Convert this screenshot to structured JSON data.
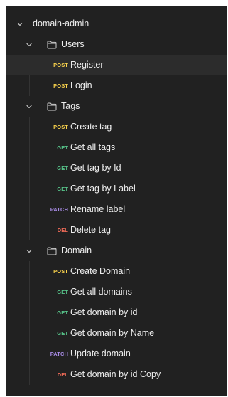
{
  "colors": {
    "POST": "#f8d14c",
    "GET": "#57c289",
    "PATCH": "#a78be4",
    "DEL": "#ec6a57",
    "text": "#ededed",
    "icon": "#cfcfcf",
    "background": "#212121",
    "selected": "#2c2c2c"
  },
  "collection": {
    "name": "domain-admin",
    "expanded": true
  },
  "folders": [
    {
      "name": "Users",
      "expanded": true,
      "requests": [
        {
          "method": "POST",
          "name": "Register",
          "selected": true
        },
        {
          "method": "POST",
          "name": "Login"
        }
      ]
    },
    {
      "name": "Tags",
      "expanded": true,
      "requests": [
        {
          "method": "POST",
          "name": "Create tag"
        },
        {
          "method": "GET",
          "name": "Get all tags"
        },
        {
          "method": "GET",
          "name": "Get tag by Id"
        },
        {
          "method": "GET",
          "name": "Get tag by Label"
        },
        {
          "method": "PATCH",
          "name": "Rename label"
        },
        {
          "method": "DEL",
          "name": "Delete tag"
        }
      ]
    },
    {
      "name": "Domain",
      "expanded": true,
      "requests": [
        {
          "method": "POST",
          "name": "Create Domain"
        },
        {
          "method": "GET",
          "name": "Get all domains"
        },
        {
          "method": "GET",
          "name": "Get domain by id"
        },
        {
          "method": "GET",
          "name": "Get domain by Name"
        },
        {
          "method": "PATCH",
          "name": "Update domain"
        },
        {
          "method": "DEL",
          "name": "Get domain by id Copy"
        }
      ]
    }
  ]
}
